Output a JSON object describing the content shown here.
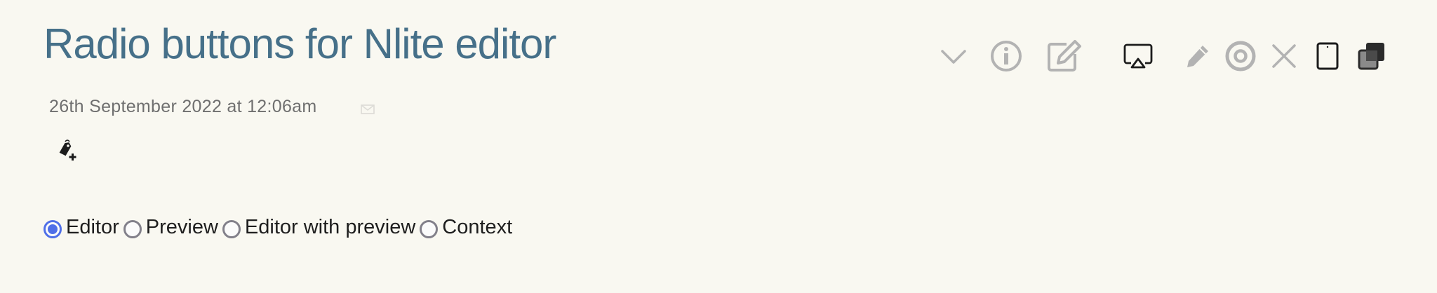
{
  "note": {
    "title": "Radio buttons for Nlite editor",
    "timestamp": "26th September 2022 at 12:06am"
  },
  "toolbar": {
    "icons": [
      "chevron-down-icon",
      "info-icon",
      "edit-icon",
      "airplay-icon",
      "pencil-icon",
      "target-icon",
      "close-icon",
      "tablet-icon",
      "clone-icon"
    ]
  },
  "editor_mode": {
    "options": [
      "Editor",
      "Preview",
      "Editor with preview",
      "Context"
    ],
    "selected": "Editor"
  },
  "colors": {
    "title": "#467089",
    "radio_accent": "#4f6fe8",
    "background": "#f9f8f1"
  }
}
